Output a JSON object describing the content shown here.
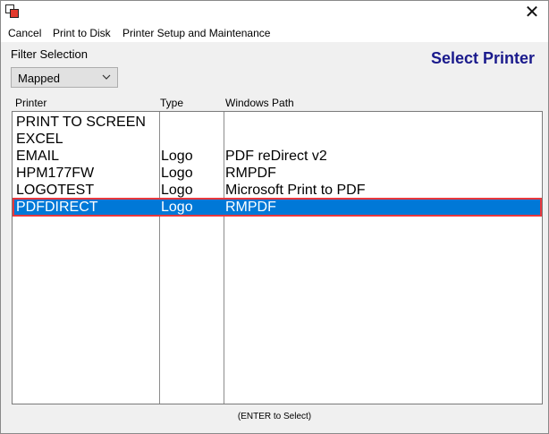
{
  "window": {
    "close_glyph": "✕"
  },
  "menu": {
    "items": [
      "Cancel",
      "Print to Disk",
      "Printer Setup and Maintenance"
    ]
  },
  "filter": {
    "label": "Filter Selection",
    "selected": "Mapped"
  },
  "page": {
    "title": "Select Printer"
  },
  "list": {
    "columns": [
      "Printer",
      "Type",
      "Windows Path"
    ],
    "rows": [
      {
        "printer": "PRINT TO SCREEN",
        "type": "",
        "path": ""
      },
      {
        "printer": "EXCEL",
        "type": "",
        "path": ""
      },
      {
        "printer": "EMAIL",
        "type": "Logo",
        "path": "PDF reDirect v2"
      },
      {
        "printer": "HPM177FW",
        "type": "Logo",
        "path": "RMPDF"
      },
      {
        "printer": "LOGOTEST",
        "type": "Logo",
        "path": "Microsoft Print to PDF"
      },
      {
        "printer": "PDFDIRECT",
        "type": "Logo",
        "path": "RMPDF"
      }
    ],
    "selected_index": 5
  },
  "status": {
    "text": "(ENTER to Select)"
  },
  "colors": {
    "title": "#1a1a8c",
    "selection": "#0078d7",
    "selection_border": "#e8383d"
  }
}
